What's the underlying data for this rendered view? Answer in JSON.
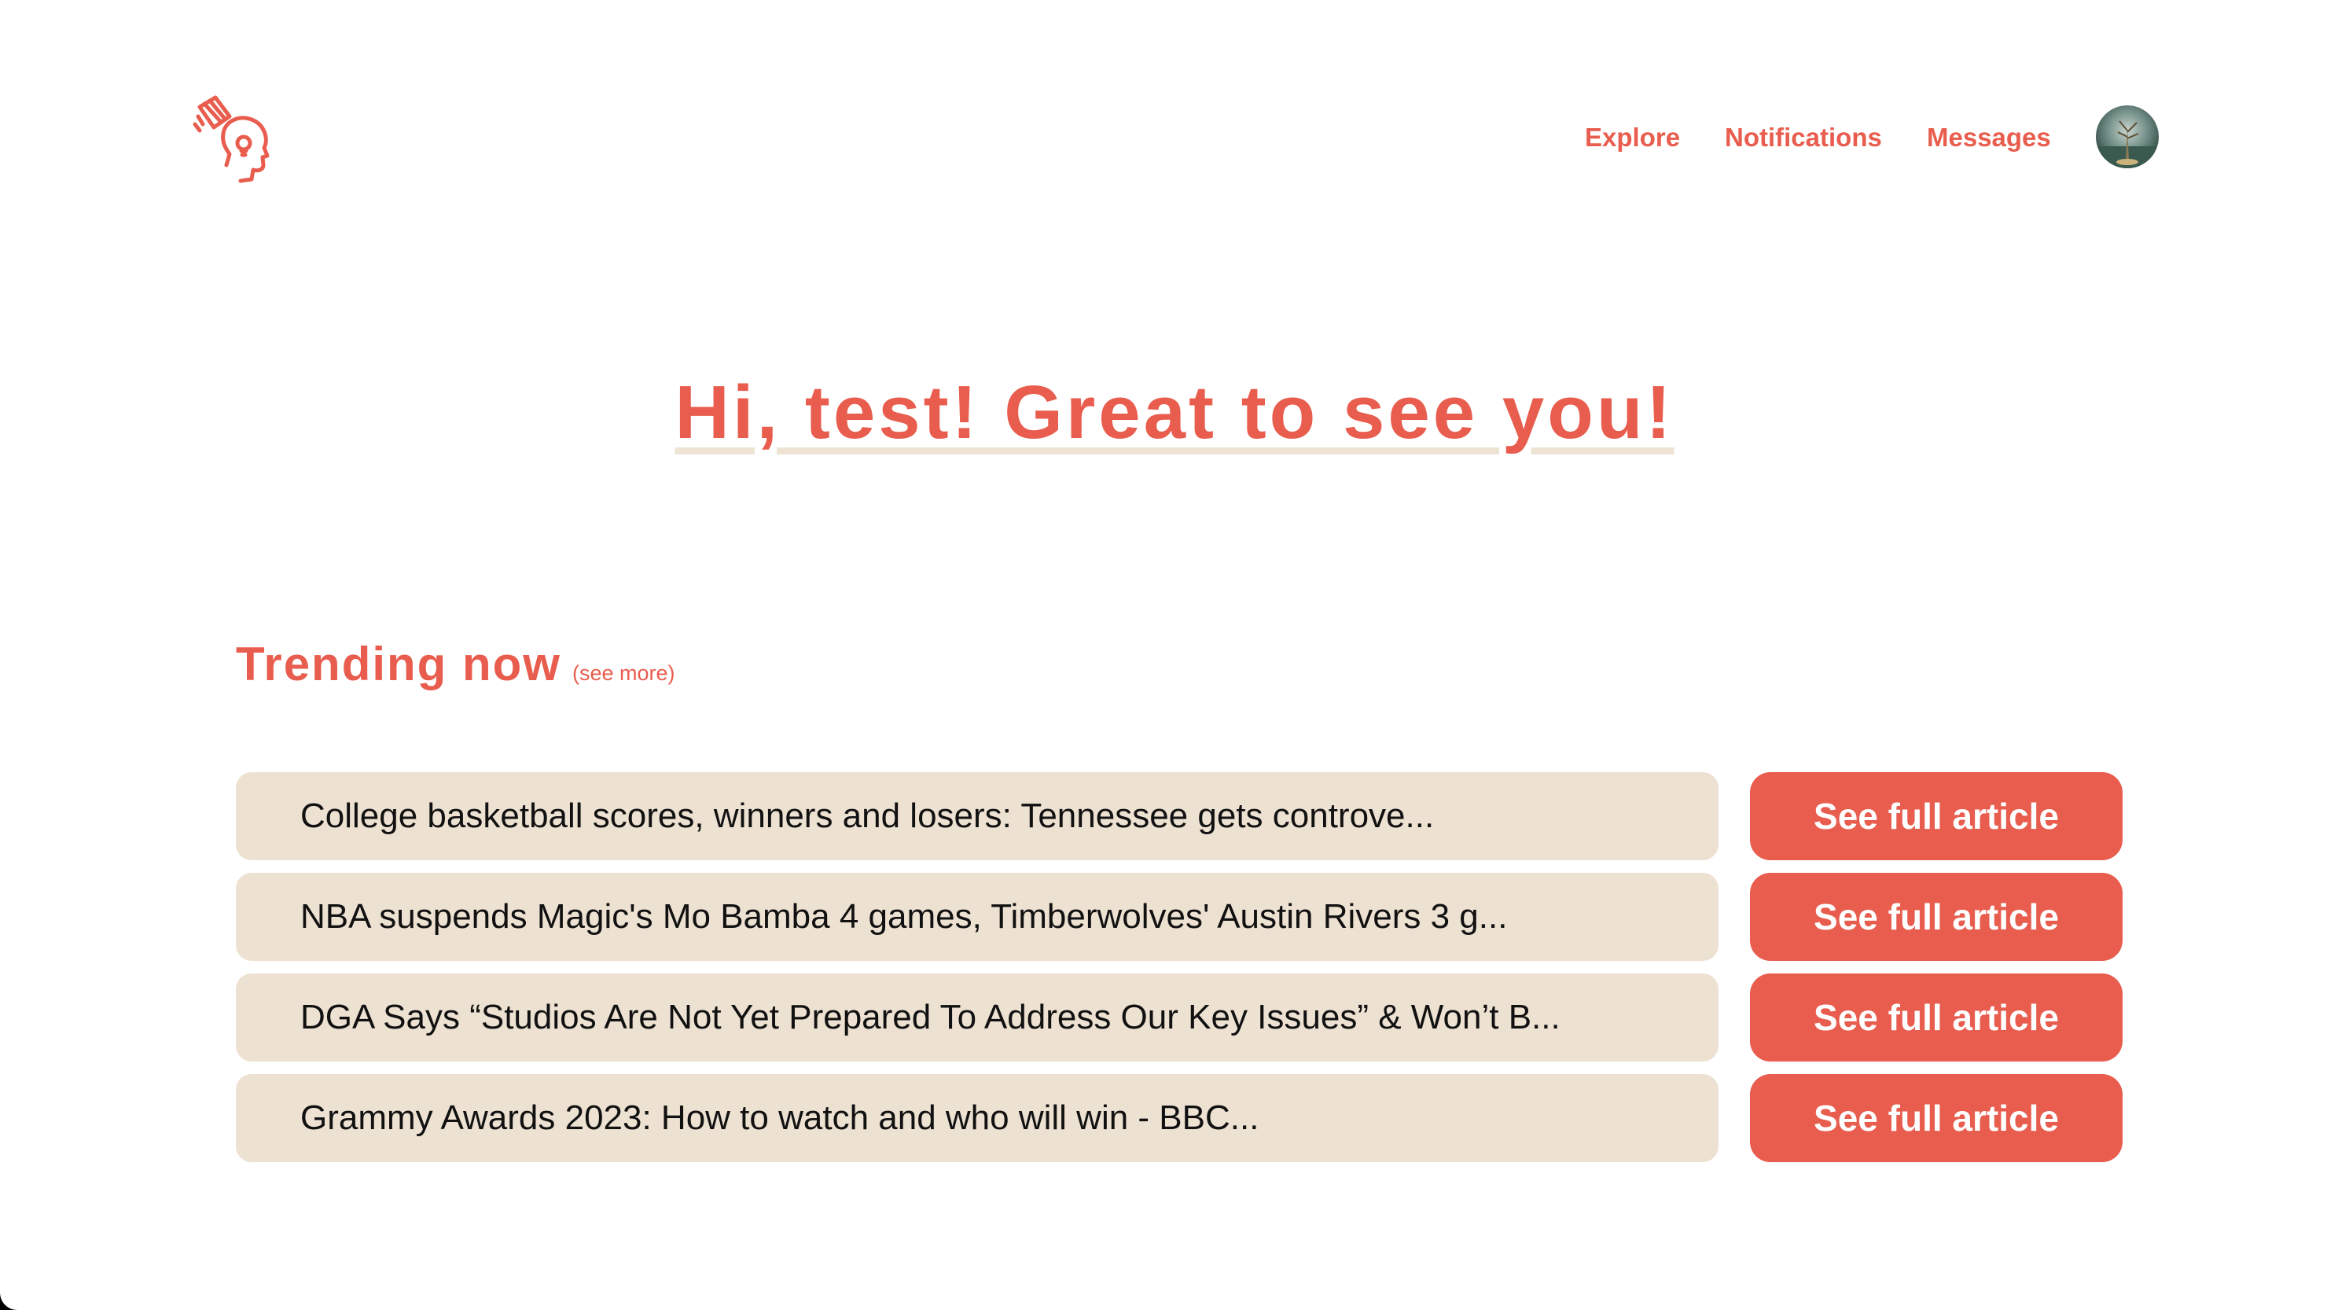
{
  "colors": {
    "accent": "#e85d4e",
    "row_bg": "#ede1d2",
    "underline": "#efe4d4"
  },
  "header": {
    "logo_icon": "head-with-pencil-logo",
    "nav": {
      "explore": "Explore",
      "notifications": "Notifications",
      "messages": "Messages"
    },
    "avatar_icon": "user-avatar"
  },
  "greeting": "Hi, test! Great to see you!",
  "trending": {
    "title": "Trending now",
    "see_more": "(see more)",
    "articles": [
      {
        "title": "College basketball scores, winners and losers: Tennessee gets controve...",
        "button": "See full article"
      },
      {
        "title": "NBA suspends Magic's Mo Bamba 4 games, Timberwolves' Austin Rivers 3 g...",
        "button": "See full article"
      },
      {
        "title": "DGA Says “Studios Are Not Yet Prepared To Address Our Key Issues” & Won’t B...",
        "button": "See full article"
      },
      {
        "title": "Grammy Awards 2023: How to watch and who will win - BBC...",
        "button": "See full article"
      }
    ]
  }
}
